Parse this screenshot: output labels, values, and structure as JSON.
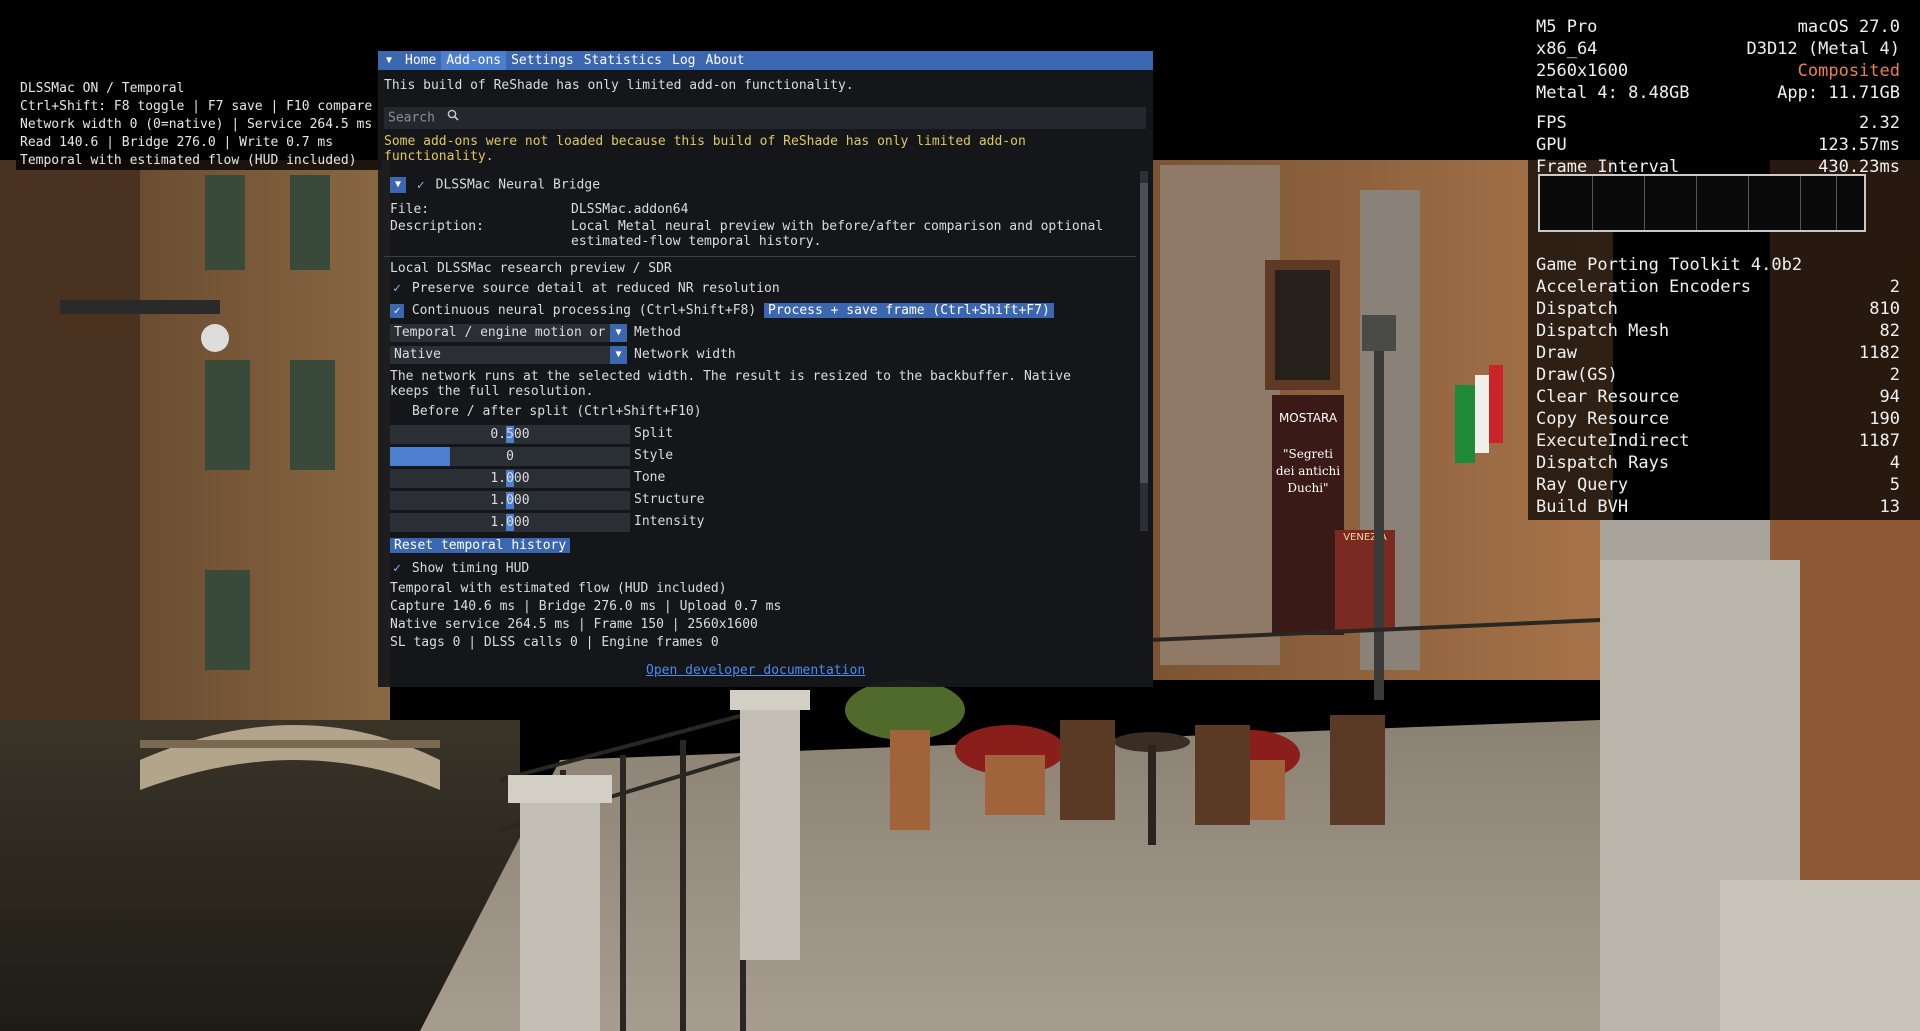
{
  "overlay_left": {
    "lines": [
      "DLSSMac ON / Temporal",
      "Ctrl+Shift: F8 toggle | F7 save | F10 compare",
      "Network width 0 (0=native) | Service 264.5 ms",
      "Read 140.6 | Bridge 276.0 | Write 0.7 ms",
      "Temporal with estimated flow (HUD included)"
    ]
  },
  "reshade": {
    "tabs": [
      "Home",
      "Add-ons",
      "Settings",
      "Statistics",
      "Log",
      "About"
    ],
    "active_tab": "Add-ons",
    "limited_notice": "This build of ReShade has only limited add-on functionality.",
    "search_placeholder": "Search",
    "warning_line1": "Some add-ons were not loaded because this build of ReShade has only limited add-on",
    "warning_line2": "functionality.",
    "addon": {
      "name": "DLSSMac Neural Bridge",
      "file_label": "File:",
      "file_value": "DLSSMac.addon64",
      "description_label": "Description:",
      "description_line1": "Local Metal neural preview with before/after comparison and optional",
      "description_line2": "estimated-flow temporal history."
    },
    "section_title": "Local DLSSMac research preview / SDR",
    "preserve_detail": "Preserve source detail at reduced NR resolution",
    "continuous_processing": "Continuous neural processing (Ctrl+Shift+F8)",
    "process_save_button": "Process + save frame (Ctrl+Shift+F7)",
    "method_value": "Temporal / engine motion or",
    "method_label": "Method",
    "network_width_value": "Native",
    "network_width_label": "Network width",
    "network_note_line1": "The network runs at the selected width. The result is resized to the backbuffer. Native",
    "network_note_line2": "keeps the full resolution.",
    "before_after_split": "Before / after split (Ctrl+Shift+F10)",
    "sliders": [
      {
        "label": "Split",
        "value": "0.500",
        "level": 0.5
      },
      {
        "label": "Style",
        "value": "0",
        "level": 0.0
      },
      {
        "label": "Tone",
        "value": "1.000",
        "level": 0.5
      },
      {
        "label": "Structure",
        "value": "1.000",
        "level": 0.5
      },
      {
        "label": "Intensity",
        "value": "1.000",
        "level": 0.5
      }
    ],
    "reset_button": "Reset temporal history",
    "show_timing_hud": "Show timing HUD",
    "timing_lines": [
      "Temporal with estimated flow (HUD included)",
      "Capture 140.6 ms | Bridge 276.0 ms | Upload 0.7 ms",
      "Native service 264.5 ms | Frame 150 | 2560x1600",
      "SL tags 0 | DLSS calls 0 | Engine frames 0"
    ],
    "docs_link": "Open developer documentation"
  },
  "stats": {
    "header": [
      {
        "left": "M5 Pro",
        "right": "macOS 27.0"
      },
      {
        "left": "x86_64",
        "right": "D3D12 (Metal 4)"
      },
      {
        "left": "2560x1600",
        "right": "Composited",
        "right_color": "#e8824a"
      },
      {
        "left": "Metal 4: 8.48GB",
        "right": "App: 11.71GB"
      }
    ],
    "perf": [
      {
        "label": "FPS",
        "value": "2.32"
      },
      {
        "label": "GPU",
        "value": "123.57ms"
      },
      {
        "label": "Frame Interval",
        "value": "430.23ms"
      }
    ],
    "toolkit_title": "Game Porting Toolkit 4.0b2",
    "counters": [
      {
        "label": "Acceleration Encoders",
        "value": "2"
      },
      {
        "label": "Dispatch",
        "value": "810"
      },
      {
        "label": "Dispatch Mesh",
        "value": "82"
      },
      {
        "label": "Draw",
        "value": "1182"
      },
      {
        "label": "Draw(GS)",
        "value": "2"
      },
      {
        "label": "Clear Resource",
        "value": "94"
      },
      {
        "label": "Copy Resource",
        "value": "190"
      },
      {
        "label": "ExecuteIndirect",
        "value": "1187"
      },
      {
        "label": "Dispatch Rays",
        "value": "4"
      },
      {
        "label": "Ray Query",
        "value": "5"
      },
      {
        "label": "Build BVH",
        "value": "13"
      }
    ]
  },
  "scene": {
    "poster_title": "MOSTARA",
    "poster_text_1": "\"Segreti",
    "poster_text_2": "dei antichi",
    "poster_text_3": "Duchi\"",
    "venezia_sign": "VENEZIA"
  },
  "colors": {
    "accent": "#3a67b0",
    "warning": "#e0c85a",
    "link": "#4d8bf0",
    "status_orange": "#e8824a"
  }
}
